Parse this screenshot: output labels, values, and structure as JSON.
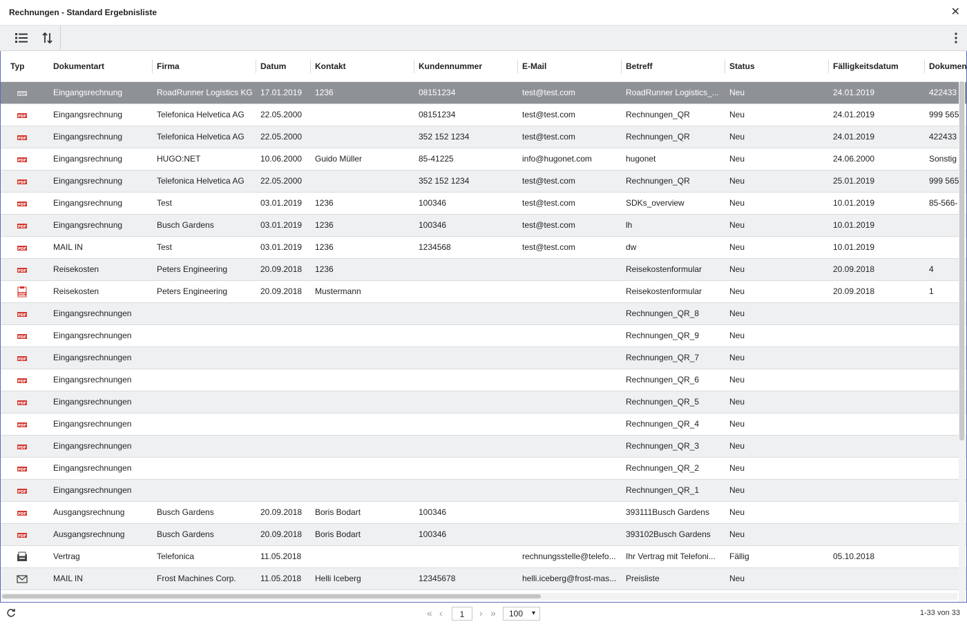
{
  "window": {
    "title": "Rechnungen - Standard Ergebnisliste",
    "close_label": "✕"
  },
  "toolbar": {
    "list_icon": "list-view-icon",
    "sort_icon": "sort-icon",
    "more_icon": "more-vertical-icon"
  },
  "columns": [
    {
      "key": "typ",
      "label": "Typ"
    },
    {
      "key": "dokumentart",
      "label": "Dokumentart"
    },
    {
      "key": "firma",
      "label": "Firma"
    },
    {
      "key": "datum",
      "label": "Datum"
    },
    {
      "key": "kontakt",
      "label": "Kontakt"
    },
    {
      "key": "kundennummer",
      "label": "Kundennummer"
    },
    {
      "key": "email",
      "label": "E-Mail"
    },
    {
      "key": "betreff",
      "label": "Betreff"
    },
    {
      "key": "status",
      "label": "Status"
    },
    {
      "key": "faellig",
      "label": "Fälligkeitsdatum"
    },
    {
      "key": "dokument",
      "label": "Dokument"
    }
  ],
  "rows": [
    {
      "icon": "pdf",
      "dokumentart": "Eingangsrechnung",
      "firma": "RoadRunner Logistics KG",
      "datum": "17.01.2019",
      "kontakt": "1236",
      "kundennummer": "08151234",
      "email": "test@test.com",
      "betreff": "RoadRunner Logistics_...",
      "status": "Neu",
      "faellig": "24.01.2019",
      "dokument": "422433"
    },
    {
      "icon": "pdf",
      "dokumentart": "Eingangsrechnung",
      "firma": "Telefonica Helvetica AG",
      "datum": "22.05.2000",
      "kontakt": "",
      "kundennummer": "08151234",
      "email": "test@test.com",
      "betreff": "Rechnungen_QR",
      "status": "Neu",
      "faellig": "24.01.2019",
      "dokument": "999 565"
    },
    {
      "icon": "pdf",
      "dokumentart": "Eingangsrechnung",
      "firma": "Telefonica Helvetica AG",
      "datum": "22.05.2000",
      "kontakt": "",
      "kundennummer": "352 152 1234",
      "email": "test@test.com",
      "betreff": "Rechnungen_QR",
      "status": "Neu",
      "faellig": "24.01.2019",
      "dokument": "422433"
    },
    {
      "icon": "pdf",
      "dokumentart": "Eingangsrechnung",
      "firma": "HUGO:NET",
      "datum": "10.06.2000",
      "kontakt": "Guido Müller",
      "kundennummer": "85-41225",
      "email": "info@hugonet.com",
      "betreff": "hugonet",
      "status": "Neu",
      "faellig": "24.06.2000",
      "dokument": "Sonstig"
    },
    {
      "icon": "pdf",
      "dokumentart": "Eingangsrechnung",
      "firma": "Telefonica Helvetica AG",
      "datum": "22.05.2000",
      "kontakt": "",
      "kundennummer": "352 152 1234",
      "email": "test@test.com",
      "betreff": "Rechnungen_QR",
      "status": "Neu",
      "faellig": "25.01.2019",
      "dokument": "999 565"
    },
    {
      "icon": "pdf",
      "dokumentart": "Eingangsrechnung",
      "firma": "Test",
      "datum": "03.01.2019",
      "kontakt": "1236",
      "kundennummer": "100346",
      "email": "test@test.com",
      "betreff": "SDKs_overview",
      "status": "Neu",
      "faellig": "10.01.2019",
      "dokument": "85-566-"
    },
    {
      "icon": "pdf",
      "dokumentart": "Eingangsrechnung",
      "firma": "Busch Gardens",
      "datum": "03.01.2019",
      "kontakt": "1236",
      "kundennummer": "100346",
      "email": "test@test.com",
      "betreff": "lh",
      "status": "Neu",
      "faellig": "10.01.2019",
      "dokument": ""
    },
    {
      "icon": "pdf",
      "dokumentart": "MAIL IN",
      "firma": "Test",
      "datum": "03.01.2019",
      "kontakt": "1236",
      "kundennummer": "1234568",
      "email": "test@test.com",
      "betreff": "dw",
      "status": "Neu",
      "faellig": "10.01.2019",
      "dokument": ""
    },
    {
      "icon": "pdf",
      "dokumentart": "Reisekosten",
      "firma": "Peters Engineering",
      "datum": "20.09.2018",
      "kontakt": "1236",
      "kundennummer": "",
      "email": "",
      "betreff": "Reisekostenformular",
      "status": "Neu",
      "faellig": "20.09.2018",
      "dokument": "4"
    },
    {
      "icon": "pdf-form",
      "dokumentart": "Reisekosten",
      "firma": "Peters Engineering",
      "datum": "20.09.2018",
      "kontakt": "Mustermann",
      "kundennummer": "",
      "email": "",
      "betreff": "Reisekostenformular",
      "status": "Neu",
      "faellig": "20.09.2018",
      "dokument": "1"
    },
    {
      "icon": "pdf",
      "dokumentart": "Eingangsrechnungen",
      "firma": "",
      "datum": "",
      "kontakt": "",
      "kundennummer": "",
      "email": "",
      "betreff": "Rechnungen_QR_8",
      "status": "Neu",
      "faellig": "",
      "dokument": ""
    },
    {
      "icon": "pdf",
      "dokumentart": "Eingangsrechnungen",
      "firma": "",
      "datum": "",
      "kontakt": "",
      "kundennummer": "",
      "email": "",
      "betreff": "Rechnungen_QR_9",
      "status": "Neu",
      "faellig": "",
      "dokument": ""
    },
    {
      "icon": "pdf",
      "dokumentart": "Eingangsrechnungen",
      "firma": "",
      "datum": "",
      "kontakt": "",
      "kundennummer": "",
      "email": "",
      "betreff": "Rechnungen_QR_7",
      "status": "Neu",
      "faellig": "",
      "dokument": ""
    },
    {
      "icon": "pdf",
      "dokumentart": "Eingangsrechnungen",
      "firma": "",
      "datum": "",
      "kontakt": "",
      "kundennummer": "",
      "email": "",
      "betreff": "Rechnungen_QR_6",
      "status": "Neu",
      "faellig": "",
      "dokument": ""
    },
    {
      "icon": "pdf",
      "dokumentart": "Eingangsrechnungen",
      "firma": "",
      "datum": "",
      "kontakt": "",
      "kundennummer": "",
      "email": "",
      "betreff": "Rechnungen_QR_5",
      "status": "Neu",
      "faellig": "",
      "dokument": ""
    },
    {
      "icon": "pdf",
      "dokumentart": "Eingangsrechnungen",
      "firma": "",
      "datum": "",
      "kontakt": "",
      "kundennummer": "",
      "email": "",
      "betreff": "Rechnungen_QR_4",
      "status": "Neu",
      "faellig": "",
      "dokument": ""
    },
    {
      "icon": "pdf",
      "dokumentart": "Eingangsrechnungen",
      "firma": "",
      "datum": "",
      "kontakt": "",
      "kundennummer": "",
      "email": "",
      "betreff": "Rechnungen_QR_3",
      "status": "Neu",
      "faellig": "",
      "dokument": ""
    },
    {
      "icon": "pdf",
      "dokumentart": "Eingangsrechnungen",
      "firma": "",
      "datum": "",
      "kontakt": "",
      "kundennummer": "",
      "email": "",
      "betreff": "Rechnungen_QR_2",
      "status": "Neu",
      "faellig": "",
      "dokument": ""
    },
    {
      "icon": "pdf",
      "dokumentart": "Eingangsrechnungen",
      "firma": "",
      "datum": "",
      "kontakt": "",
      "kundennummer": "",
      "email": "",
      "betreff": "Rechnungen_QR_1",
      "status": "Neu",
      "faellig": "",
      "dokument": ""
    },
    {
      "icon": "pdf",
      "dokumentart": "Ausgangsrechnung",
      "firma": "Busch Gardens",
      "datum": "20.09.2018",
      "kontakt": "Boris Bodart",
      "kundennummer": "100346",
      "email": "",
      "betreff": "393111Busch Gardens",
      "status": "Neu",
      "faellig": "",
      "dokument": ""
    },
    {
      "icon": "pdf",
      "dokumentart": "Ausgangsrechnung",
      "firma": "Busch Gardens",
      "datum": "20.09.2018",
      "kontakt": "Boris Bodart",
      "kundennummer": "100346",
      "email": "",
      "betreff": "393102Busch Gardens",
      "status": "Neu",
      "faellig": "",
      "dokument": ""
    },
    {
      "icon": "contract",
      "dokumentart": "Vertrag",
      "firma": "Telefonica",
      "datum": "11.05.2018",
      "kontakt": "",
      "kundennummer": "",
      "email": "rechnungsstelle@telefo...",
      "betreff": "Ihr Vertrag mit Telefoni...",
      "status": "Fällig",
      "faellig": "05.10.2018",
      "dokument": ""
    },
    {
      "icon": "mail",
      "dokumentart": "MAIL IN",
      "firma": "Frost Machines Corp.",
      "datum": "11.05.2018",
      "kontakt": "Helli Iceberg",
      "kundennummer": "12345678",
      "email": "helli.iceberg@frost-mas...",
      "betreff": "Preisliste",
      "status": "Neu",
      "faellig": "",
      "dokument": ""
    }
  ],
  "selected_row": 0,
  "footer": {
    "page": "1",
    "page_size": "100",
    "count": "1-33 von 33",
    "first_label": "«",
    "prev_label": "‹",
    "next_label": "›",
    "last_label": "»"
  },
  "colors": {
    "pdf_red": "#d4342c",
    "selected_bg": "#8e9296",
    "accent_border": "#5b6bbf"
  }
}
